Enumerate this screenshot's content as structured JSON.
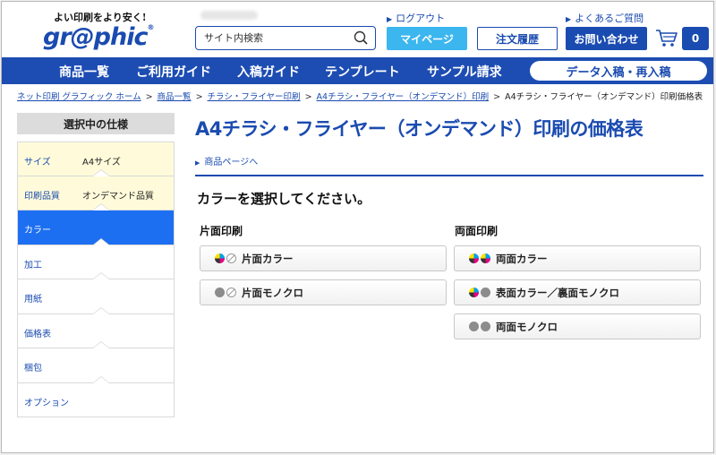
{
  "header": {
    "tagline": "よい印刷をより安く!",
    "logo": "gr@phic",
    "logo_mark": "®",
    "search_placeholder": "サイト内検索",
    "logout": "ログアウト",
    "faq": "よくあるご質問",
    "mypage": "マイページ",
    "order_history": "注文履歴",
    "contact": "お問い合わせ",
    "cart_count": "0"
  },
  "nav": {
    "items": [
      "商品一覧",
      "ご利用ガイド",
      "入稿ガイド",
      "テンプレート",
      "サンプル請求"
    ],
    "pill": "データ入稿・再入稿"
  },
  "breadcrumb": {
    "items": [
      "ネット印刷 グラフィック ホーム",
      "商品一覧",
      "チラシ・フライヤー印刷",
      "A4チラシ・フライヤー（オンデマンド）印刷"
    ],
    "current": "A4チラシ・フライヤー（オンデマンド）印刷価格表",
    "sep": ">"
  },
  "sidebar": {
    "heading": "選択中の仕様",
    "items": [
      {
        "label": "サイズ",
        "value": "A4サイズ"
      },
      {
        "label": "印刷品質",
        "value": "オンデマンド品質"
      },
      {
        "label": "カラー",
        "value": ""
      },
      {
        "label": "加工",
        "value": ""
      },
      {
        "label": "用紙",
        "value": ""
      },
      {
        "label": "価格表",
        "value": ""
      },
      {
        "label": "梱包",
        "value": ""
      },
      {
        "label": "オプション",
        "value": ""
      }
    ]
  },
  "main": {
    "title": "A4チラシ・フライヤー（オンデマンド）印刷の価格表",
    "product_link": "商品ページへ",
    "prompt": "カラーを選択してください。",
    "single_heading": "片面印刷",
    "double_heading": "両面印刷",
    "single_options": [
      {
        "label": "片面カラー",
        "icons": [
          "color",
          "none"
        ]
      },
      {
        "label": "片面モノクロ",
        "icons": [
          "mono",
          "none"
        ]
      }
    ],
    "double_options": [
      {
        "label": "両面カラー",
        "icons": [
          "color",
          "color"
        ]
      },
      {
        "label": "表面カラー／裏面モノクロ",
        "icons": [
          "color",
          "mono"
        ]
      },
      {
        "label": "両面モノクロ",
        "icons": [
          "mono",
          "mono"
        ]
      }
    ]
  },
  "colors": {
    "brand": "#1a4bb0",
    "active": "#1d6ff2",
    "accent": "#3cb6ef",
    "selected_bg": "#fffbda"
  }
}
